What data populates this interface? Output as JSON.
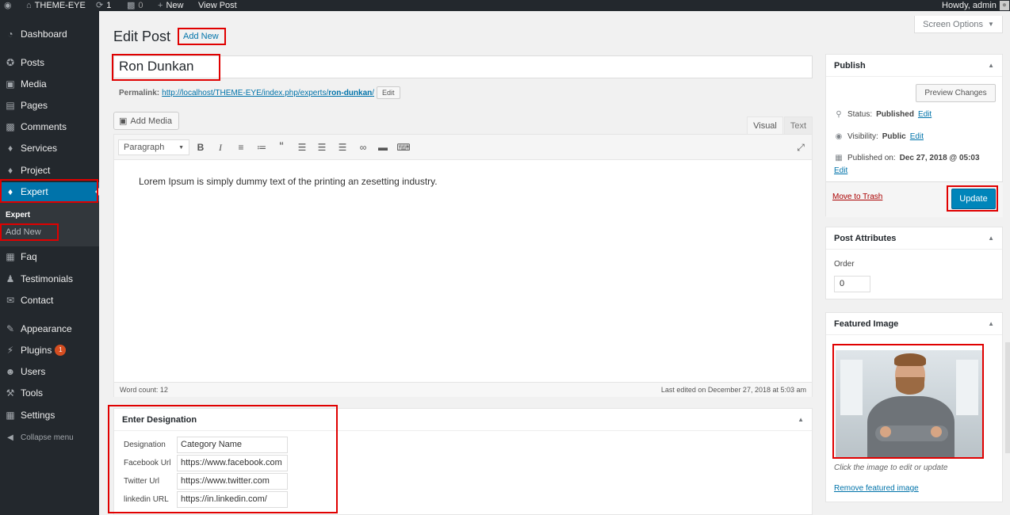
{
  "admin_bar": {
    "site_name": "THEME-EYE",
    "updates_count": "1",
    "comments_count": "0",
    "new_label": "New",
    "view_post_label": "View Post",
    "howdy": "Howdy, admin"
  },
  "sidebar": {
    "items": [
      {
        "label": "Dashboard",
        "icon": "dashboard-icon"
      },
      {
        "label": "Posts",
        "icon": "pin-icon"
      },
      {
        "label": "Media",
        "icon": "media-icon"
      },
      {
        "label": "Pages",
        "icon": "pages-icon"
      },
      {
        "label": "Comments",
        "icon": "comment-icon"
      },
      {
        "label": "Services",
        "icon": "tag-icon"
      },
      {
        "label": "Project",
        "icon": "tag-icon"
      },
      {
        "label": "Expert",
        "icon": "tag-icon"
      },
      {
        "label": "Faq",
        "icon": "faq-icon"
      },
      {
        "label": "Testimonials",
        "icon": "people-icon"
      },
      {
        "label": "Contact",
        "icon": "mail-icon"
      },
      {
        "label": "Appearance",
        "icon": "brush-icon"
      },
      {
        "label": "Plugins",
        "icon": "plugin-icon",
        "badge": "1"
      },
      {
        "label": "Users",
        "icon": "user-icon"
      },
      {
        "label": "Tools",
        "icon": "wrench-icon"
      },
      {
        "label": "Settings",
        "icon": "settings-icon"
      }
    ],
    "submenu_heading": "Expert",
    "submenu_add_new": "Add New",
    "collapse_label": "Collapse menu"
  },
  "screen_options": "Screen Options",
  "page": {
    "title": "Edit Post",
    "add_new": "Add New"
  },
  "post": {
    "title": "Ron Dunkan",
    "permalink_label": "Permalink:",
    "permalink_base": "http://localhost/THEME-EYE/index.php/experts/",
    "permalink_slug": "ron-dunkan",
    "permalink_end": "/",
    "permalink_edit": "Edit"
  },
  "editor": {
    "add_media": "Add Media",
    "tab_visual": "Visual",
    "tab_text": "Text",
    "format": "Paragraph",
    "content": "Lorem Ipsum is simply dummy text of the printing an zesetting industry.",
    "word_count": "Word count: 12",
    "last_edited": "Last edited on December 27, 2018 at 5:03 am"
  },
  "designation_box": {
    "title": "Enter Designation",
    "fields": [
      {
        "label": "Designation",
        "value": "Category Name"
      },
      {
        "label": "Facebook Url",
        "value": "https://www.facebook.com"
      },
      {
        "label": "Twitter Url",
        "value": "https://www.twitter.com"
      },
      {
        "label": "linkedin URL",
        "value": "https://in.linkedin.com/"
      }
    ]
  },
  "publish": {
    "title": "Publish",
    "preview": "Preview Changes",
    "status_label": "Status:",
    "status_value": "Published",
    "visibility_label": "Visibility:",
    "visibility_value": "Public",
    "published_on_label": "Published on:",
    "published_on_value": "Dec 27, 2018 @ 05:03",
    "edit": "Edit",
    "move_to_trash": "Move to Trash",
    "update": "Update"
  },
  "post_attributes": {
    "title": "Post Attributes",
    "order_label": "Order",
    "order_value": "0"
  },
  "featured_image": {
    "title": "Featured Image",
    "caption": "Click the image to edit or update",
    "remove": "Remove featured image"
  },
  "colors": {
    "sidebar_bg": "#23282d",
    "accent": "#0073aa",
    "highlight_box": "#e00000",
    "update_button": "#0085ba"
  }
}
